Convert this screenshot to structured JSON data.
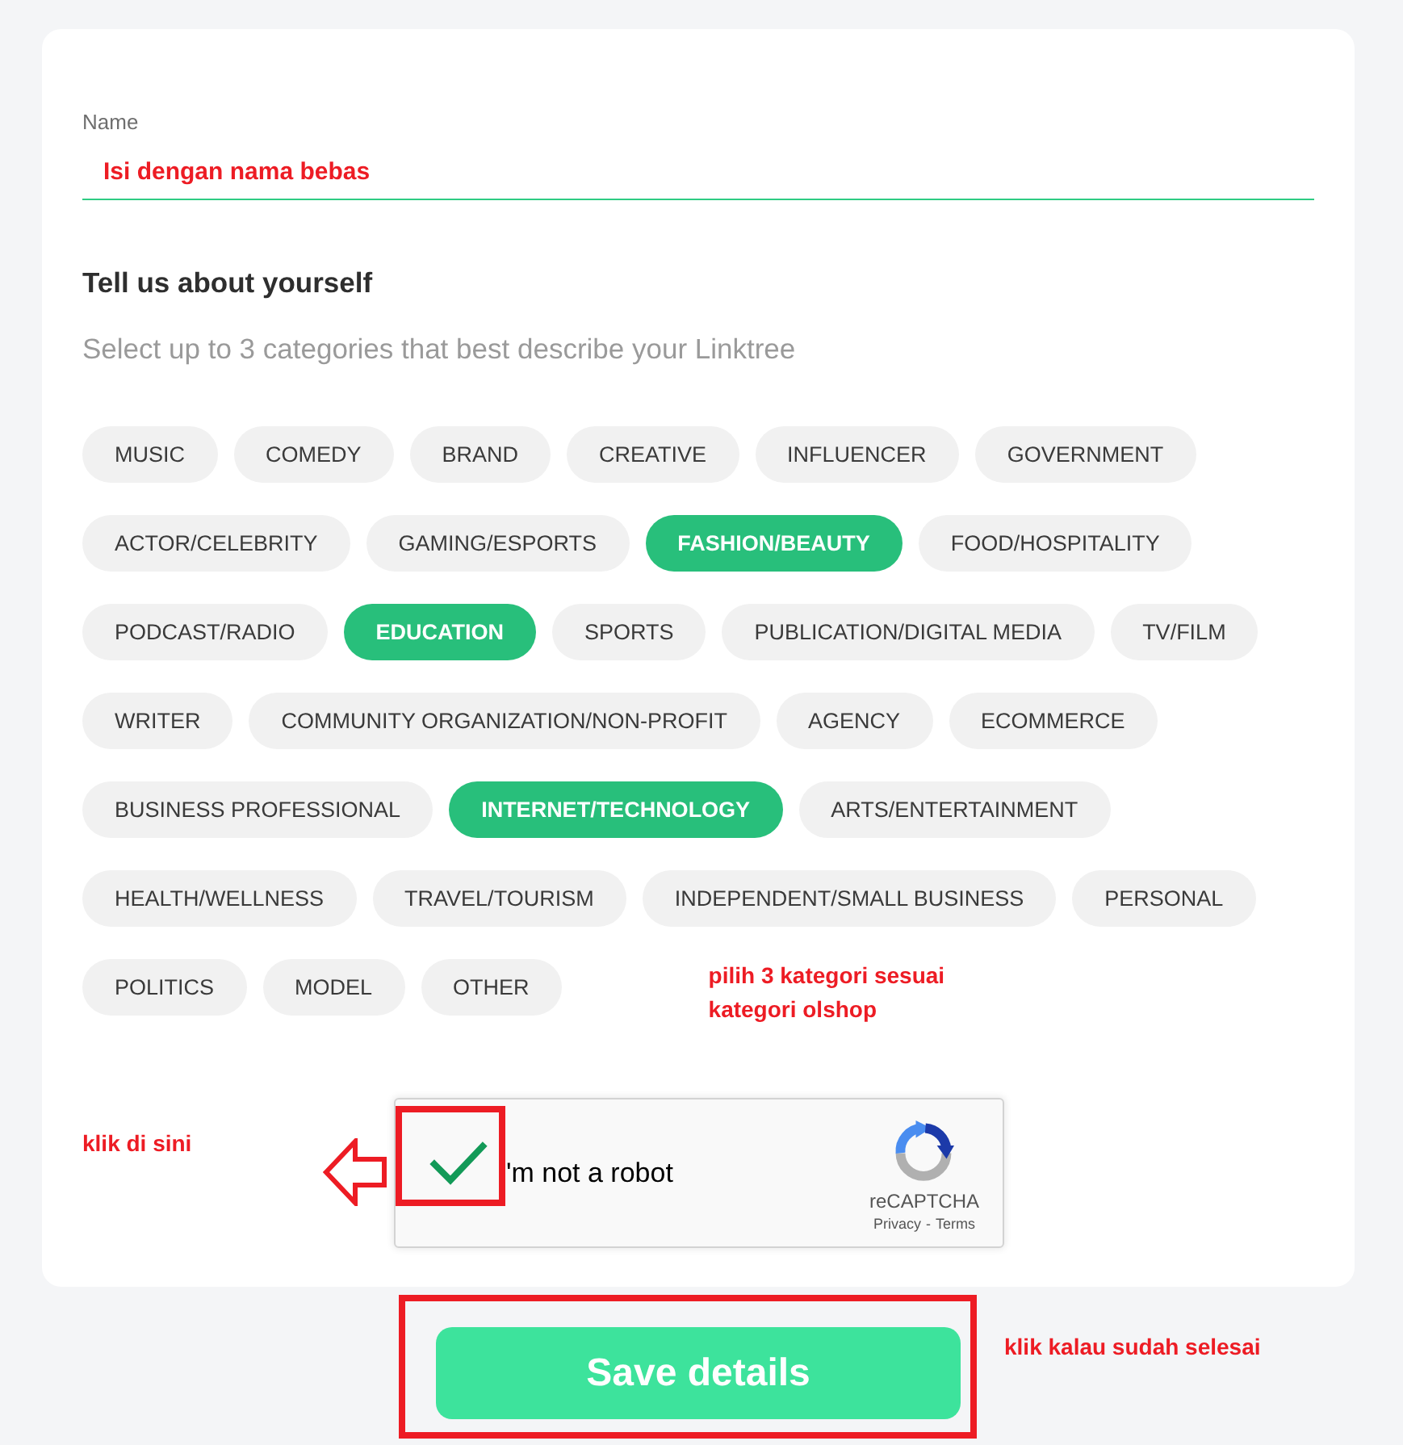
{
  "form": {
    "name_field": {
      "label": "Name",
      "value": "Isi dengan nama bebas"
    },
    "heading": "Tell us about yourself",
    "subtitle": "Select up to 3 categories that best describe your Linktree",
    "categories": [
      {
        "label": "MUSIC",
        "selected": false
      },
      {
        "label": "COMEDY",
        "selected": false
      },
      {
        "label": "BRAND",
        "selected": false
      },
      {
        "label": "CREATIVE",
        "selected": false
      },
      {
        "label": "INFLUENCER",
        "selected": false
      },
      {
        "label": "GOVERNMENT",
        "selected": false
      },
      {
        "label": "ACTOR/CELEBRITY",
        "selected": false
      },
      {
        "label": "GAMING/ESPORTS",
        "selected": false
      },
      {
        "label": "FASHION/BEAUTY",
        "selected": true
      },
      {
        "label": "FOOD/HOSPITALITY",
        "selected": false
      },
      {
        "label": "PODCAST/RADIO",
        "selected": false
      },
      {
        "label": "EDUCATION",
        "selected": true
      },
      {
        "label": "SPORTS",
        "selected": false
      },
      {
        "label": "PUBLICATION/DIGITAL MEDIA",
        "selected": false
      },
      {
        "label": "TV/FILM",
        "selected": false
      },
      {
        "label": "WRITER",
        "selected": false
      },
      {
        "label": "COMMUNITY ORGANIZATION/NON-PROFIT",
        "selected": false
      },
      {
        "label": "AGENCY",
        "selected": false
      },
      {
        "label": "ECOMMERCE",
        "selected": false
      },
      {
        "label": "BUSINESS PROFESSIONAL",
        "selected": false
      },
      {
        "label": "INTERNET/TECHNOLOGY",
        "selected": true
      },
      {
        "label": "ARTS/ENTERTAINMENT",
        "selected": false
      },
      {
        "label": "HEALTH/WELLNESS",
        "selected": false
      },
      {
        "label": "TRAVEL/TOURISM",
        "selected": false
      },
      {
        "label": "INDEPENDENT/SMALL BUSINESS",
        "selected": false
      },
      {
        "label": "PERSONAL",
        "selected": false
      },
      {
        "label": "POLITICS",
        "selected": false
      },
      {
        "label": "MODEL",
        "selected": false
      },
      {
        "label": "OTHER",
        "selected": false
      }
    ],
    "categories_note": "pilih 3 kategori sesuai kategori olshop",
    "captcha": {
      "checked": true,
      "label": "'m not a robot",
      "brand": "reCAPTCHA",
      "links": [
        "Privacy",
        "Terms"
      ],
      "separator": "-",
      "note": "klik di sini"
    }
  },
  "save": {
    "label": "Save details",
    "note": "klik kalau sudah selesai"
  }
}
